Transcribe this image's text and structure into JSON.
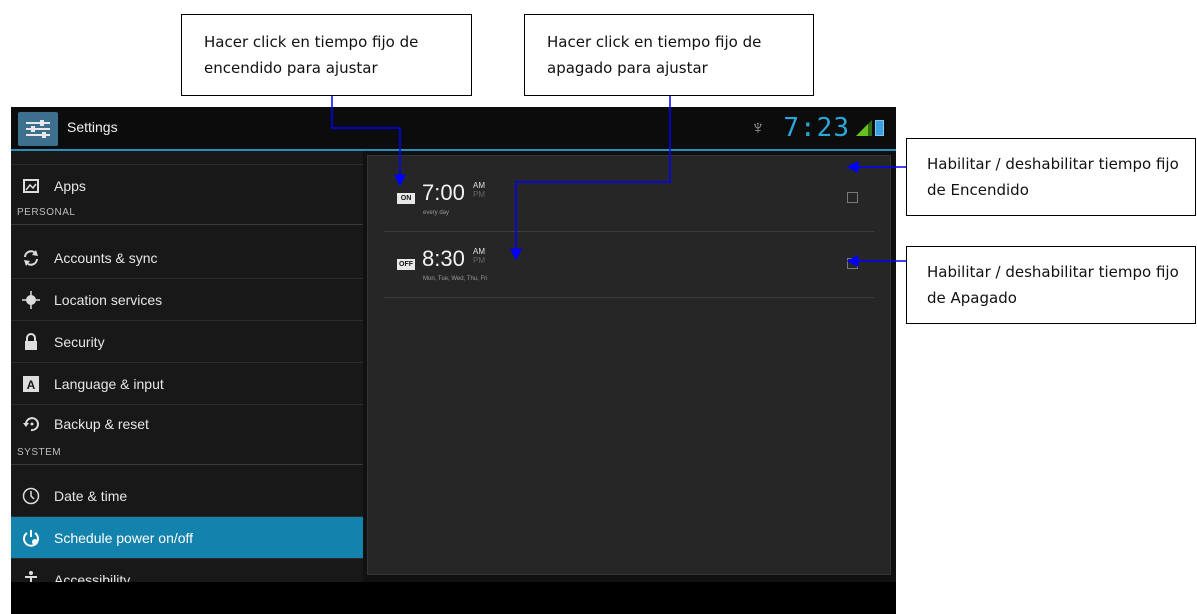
{
  "annotations": {
    "set_on_time": "Hacer click en tiempo fijo de encendido para ajustar",
    "set_off_time": "Hacer click en tiempo fijo de apagado para ajustar",
    "enable_on": "Habilitar / deshabilitar tiempo fijo de Encendido",
    "enable_off": "Habilitar / deshabilitar tiempo fijo de Apagado"
  },
  "action_bar": {
    "title": "Settings",
    "clock": "7:23",
    "icons": [
      "settings-app-icon",
      "usb-icon",
      "signal-icon",
      "battery-icon"
    ]
  },
  "sidebar": {
    "items": [
      {
        "label": "Apps",
        "icon": "apps-icon"
      },
      {
        "label": "Accounts & sync",
        "icon": "sync-icon"
      },
      {
        "label": "Location services",
        "icon": "location-icon"
      },
      {
        "label": "Security",
        "icon": "lock-icon"
      },
      {
        "label": "Language & input",
        "icon": "language-icon"
      },
      {
        "label": "Backup & reset",
        "icon": "backup-icon"
      },
      {
        "label": "Date & time",
        "icon": "clock-icon"
      },
      {
        "label": "Schedule power on/off",
        "icon": "power-schedule-icon",
        "selected": true
      },
      {
        "label": "Accessibility",
        "icon": "accessibility-icon"
      }
    ],
    "sections": {
      "personal": "PERSONAL",
      "system": "SYSTEM"
    }
  },
  "schedule": [
    {
      "badge": "ON",
      "time": "7:00",
      "am": "AM",
      "pm": "PM",
      "days": "every day",
      "enabled": false
    },
    {
      "badge": "OFF",
      "time": "8:30",
      "am": "AM",
      "pm": "PM",
      "days": "Mon, Tue, Wed, Thu, Fri",
      "enabled": false
    }
  ],
  "colors": {
    "accent": "#2aa7d8",
    "selected": "#1383ad",
    "arrow": "#0000ff"
  }
}
